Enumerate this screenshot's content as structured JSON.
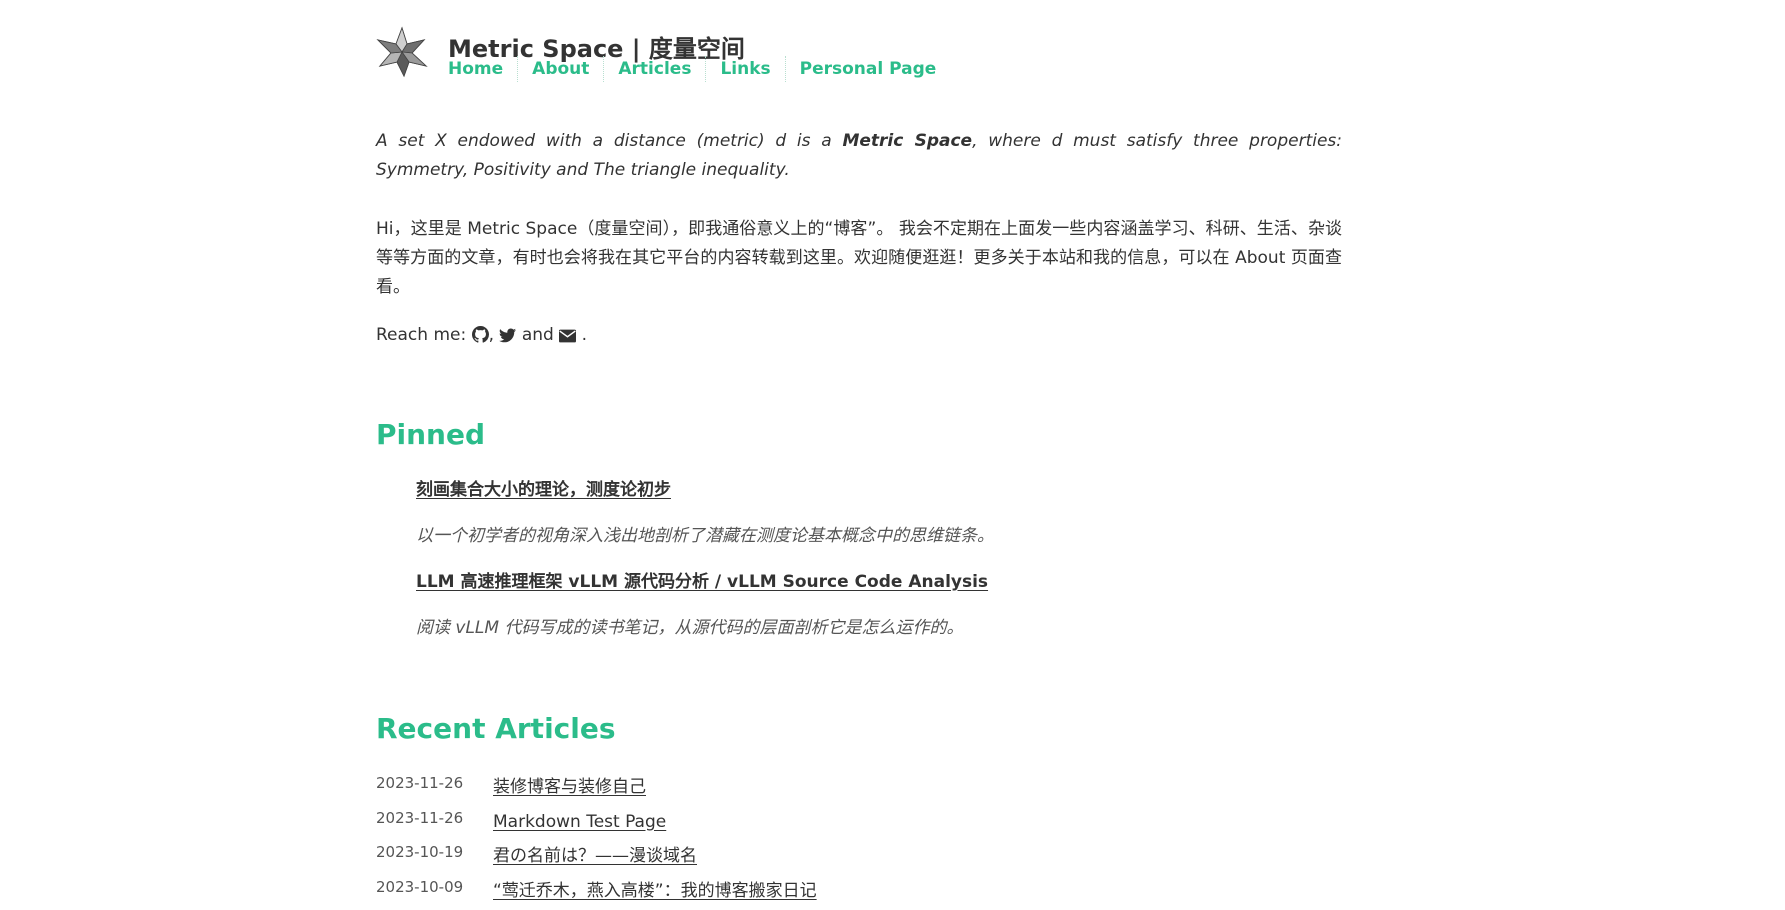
{
  "site": {
    "title": "Metric Space | 度量空间",
    "logo_icon": "stellated-polyhedron-logo"
  },
  "nav": {
    "items": [
      {
        "label": "Home"
      },
      {
        "label": "About"
      },
      {
        "label": "Articles"
      },
      {
        "label": "Links"
      },
      {
        "label": "Personal Page"
      }
    ]
  },
  "intro": {
    "before_bold": "A set X endowed with a distance (metric) d is a ",
    "bold": "Metric Space",
    "after_bold": ", where d must satisfy three properties: Symmetry, Positivity and The triangle inequality."
  },
  "bio": "Hi，这里是 Metric Space（度量空间），即我通俗意义上的“博客”。 我会不定期在上面发一些内容涵盖学习、科研、生活、杂谈等等方面的文章，有时也会将我在其它平台的内容转载到这里。欢迎随便逛逛！更多关于本站和我的信息，可以在 About 页面查看。",
  "reach": {
    "prefix": "Reach me: ",
    "sep1": ",",
    "sep2": " and ",
    "suffix": " .",
    "icons": [
      "github-icon",
      "twitter-icon",
      "envelope-icon"
    ]
  },
  "pinned": {
    "title": "Pinned",
    "items": [
      {
        "title": "刻画集合大小的理论，测度论初步",
        "desc": "以一个初学者的视角深入浅出地剖析了潜藏在测度论基本概念中的思维链条。"
      },
      {
        "title": "LLM 高速推理框架 vLLM 源代码分析 / vLLM Source Code Analysis",
        "desc": "阅读 vLLM 代码写成的读书笔记，从源代码的层面剖析它是怎么运作的。"
      }
    ]
  },
  "recent": {
    "title": "Recent Articles",
    "items": [
      {
        "date": "2023-11-26",
        "title": "装修博客与装修自己"
      },
      {
        "date": "2023-11-26",
        "title": "Markdown Test Page"
      },
      {
        "date": "2023-10-19",
        "title": "君の名前は？——漫谈域名"
      },
      {
        "date": "2023-10-09",
        "title": "“莺迁乔木，燕入高楼”：我的博客搬家日记"
      }
    ]
  },
  "colors": {
    "accent": "#2bbc8a",
    "text": "#333333"
  }
}
